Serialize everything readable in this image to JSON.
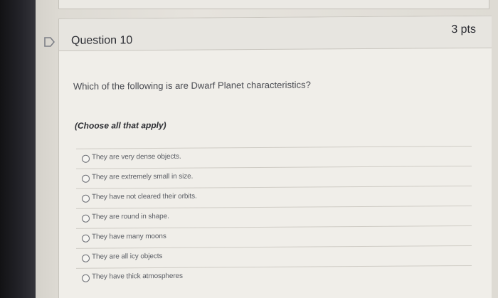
{
  "question": {
    "title": "Question 10",
    "points": "3 pts",
    "text": "Which of the following is are Dwarf Planet characteristics?",
    "instruction": "(Choose all that apply)",
    "answers": [
      {
        "label": "They are very dense objects."
      },
      {
        "label": "They are extremely small in size."
      },
      {
        "label": "They have not cleared their orbits."
      },
      {
        "label": "They are round in shape."
      },
      {
        "label": "They have many moons"
      },
      {
        "label": "They are all icy objects"
      },
      {
        "label": "They have thick atmospheres"
      }
    ]
  },
  "icons": {
    "flag": "flag-outline-icon",
    "radio": "radio-unchecked-icon"
  },
  "colors": {
    "background": "#e3e0da",
    "card": "#f0eee9",
    "text": "#2c2d33",
    "muted_text": "#5a5d64",
    "bezel": "#1a1a1e"
  }
}
